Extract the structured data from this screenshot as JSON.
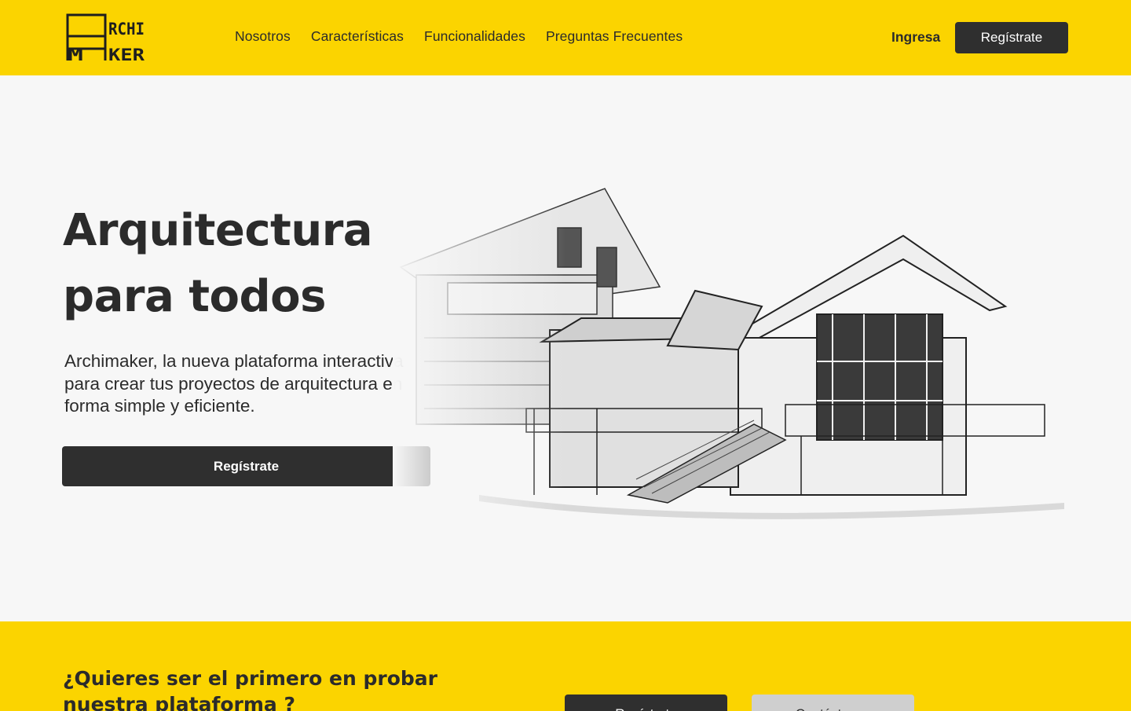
{
  "brand": {
    "logo_line1": "ARCHI",
    "logo_line2": "MAKER",
    "accent_color": "#fbd400",
    "dark_color": "#2f2f2f"
  },
  "nav": {
    "items": [
      {
        "label": "Nosotros"
      },
      {
        "label": "Características"
      },
      {
        "label": "Funcionalidades"
      },
      {
        "label": "Preguntas Frecuentes"
      }
    ],
    "login_label": "Ingresa",
    "signup_label": "Regístrate"
  },
  "hero": {
    "title_line1": "Arquitectura",
    "title_line2": "para todos",
    "description": "Archimaker, la nueva plataforma interactiva para crear tus proyectos de arquitectura en forma simple y eficiente.",
    "cta_label": "Regístrate",
    "illustration_icon": "house-sketch-illustration"
  },
  "band": {
    "title": "¿Quieres ser el primero en probar nuestra plataforma ?",
    "primary_label": "Regístrate",
    "secondary_label": "Contáctanos"
  }
}
